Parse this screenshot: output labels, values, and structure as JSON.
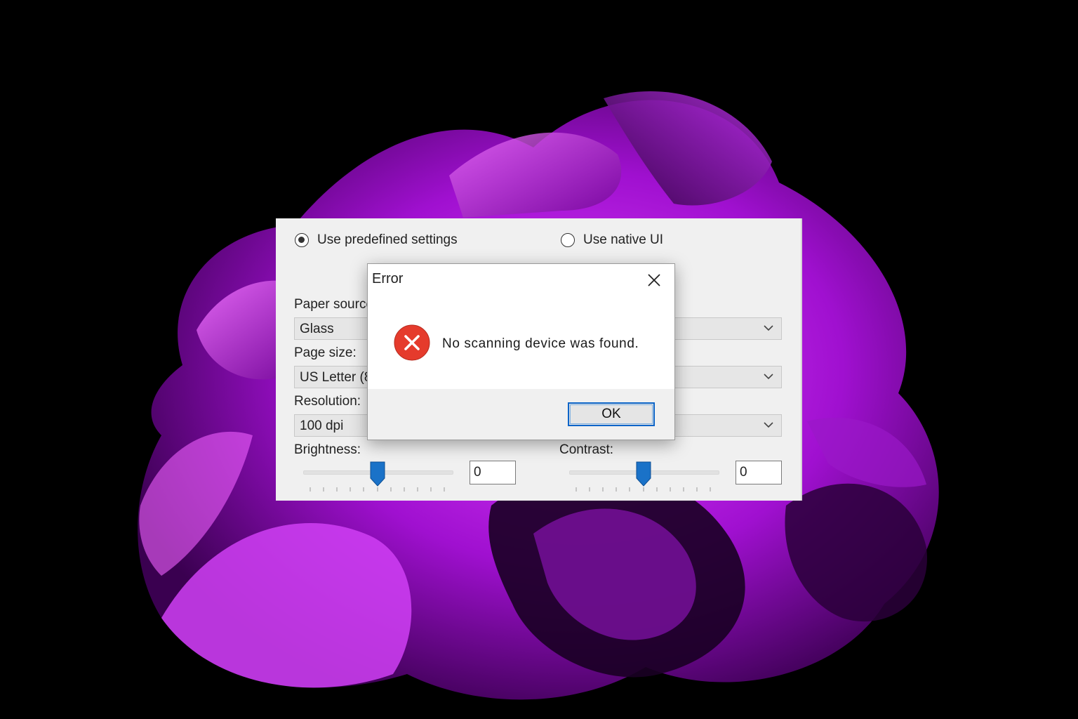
{
  "colors": {
    "wallpaper_background": "#000000",
    "wallpaper_accent": "#b320e0",
    "panel_background": "#f0f0f0",
    "slider_thumb": "#1a72c8",
    "error_icon": "#e53b2c",
    "ok_button_focus": "#0a64c8"
  },
  "settings_panel": {
    "mode_options": [
      {
        "label": "Use predefined settings",
        "selected": true,
        "icon": "radio-selected-icon"
      },
      {
        "label": "Use native UI",
        "selected": false,
        "icon": "radio-empty-icon"
      }
    ],
    "left_column": {
      "paper_source": {
        "label": "Paper source",
        "value": "Glass"
      },
      "page_size": {
        "label": "Page size:",
        "value": "US Letter (8"
      },
      "resolution": {
        "label": "Resolution:",
        "value": "100 dpi"
      },
      "brightness": {
        "label": "Brightness:",
        "value": "0",
        "slider_position": 0.5
      }
    },
    "right_column": {
      "contrast": {
        "label": "Contrast:",
        "value": "0",
        "slider_position": 0.5
      }
    },
    "combo_icon": "chevron-down-icon"
  },
  "error_dialog": {
    "title": "Error",
    "close_icon": "close-icon",
    "error_icon": "error-x-icon",
    "message": "No scanning device was found.",
    "ok_label": "OK"
  }
}
